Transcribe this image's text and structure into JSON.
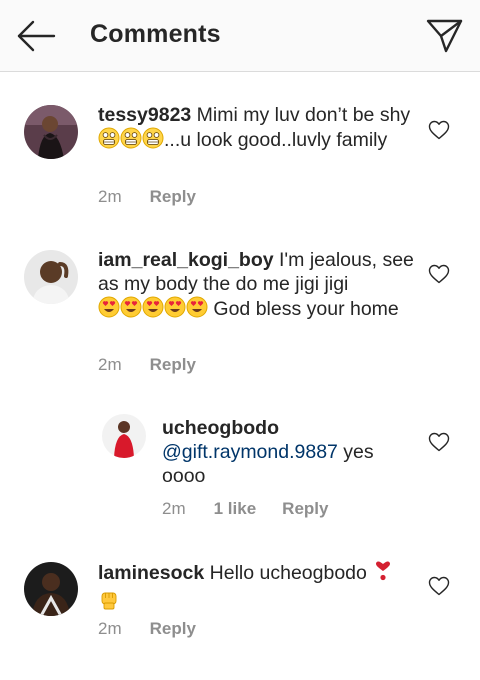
{
  "header": {
    "title": "Comments"
  },
  "icons": {
    "back": "arrow-left-icon",
    "send": "paper-plane-icon",
    "like": "heart-outline-icon"
  },
  "colors": {
    "mention": "#003569",
    "meta": "#8e8e8e",
    "heart_emoji": "#d42030",
    "header_bg": "#fafafa"
  },
  "comments": [
    {
      "username": "tessy9823",
      "text_1": " Mimi my luv don’t be shy",
      "text_2": "...u look good..luvly family",
      "emojis": "grimacing-face x3",
      "time": "2m",
      "reply": "Reply"
    },
    {
      "username": "iam_real_kogi_boy",
      "text_1": " I'm  jealous, see as my body the do me jigi jigi",
      "text_2": " God bless your home",
      "emojis": "heart-eyes-face x5",
      "time": "2m",
      "reply": "Reply"
    },
    {
      "username": "ucheogbodo",
      "mention": "@gift.raymond.9887",
      "text_1": " yes oooo",
      "time": "2m",
      "likes": "1 like",
      "reply": "Reply",
      "is_reply": true
    },
    {
      "username": "laminesock",
      "text_1": " Hello ucheogbodo ",
      "emojis": "red-heart-exclamation, raised-fist",
      "time": "2m",
      "reply": "Reply"
    }
  ]
}
